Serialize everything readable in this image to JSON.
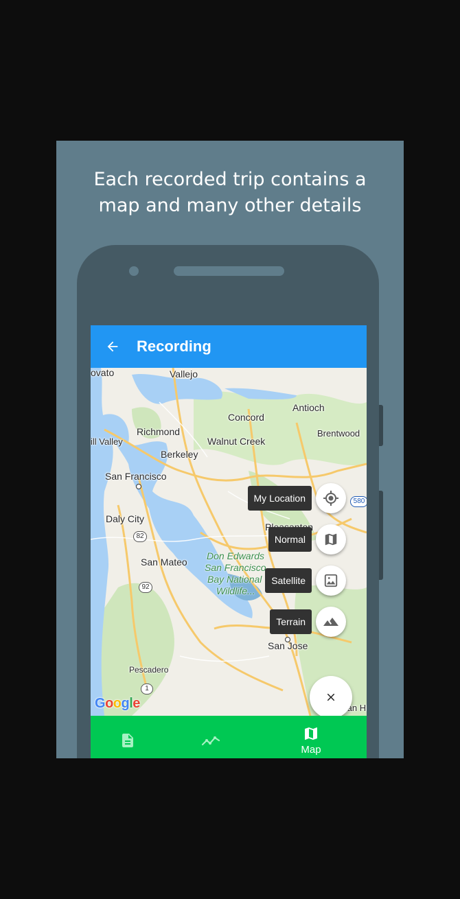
{
  "headline": {
    "line1": "Each recorded trip contains a",
    "line2": "map and many other details"
  },
  "appbar": {
    "title": "Recording",
    "back_icon": "arrow-back-icon"
  },
  "map": {
    "places": {
      "novato": "ovato",
      "vallejo": "Vallejo",
      "antioch": "Antioch",
      "concord": "Concord",
      "richmond": "Richmond",
      "walnut_creek": "Walnut Creek",
      "brentwood": "Brentwood",
      "mill_valley": "ill Valley",
      "berkeley": "Berkeley",
      "san_francisco": "San Francisco",
      "daly_city": "Daly City",
      "pleasanton": "Pleasanton",
      "san_mateo": "San Mateo",
      "san_jose": "San Jose",
      "pescadero": "Pescadero",
      "morgan_hill": "Morgan Hil"
    },
    "park": {
      "line1": "Don Edwards",
      "line2": "San Francisco",
      "line3": "Bay National",
      "line4": "Wildlife..."
    },
    "shields": {
      "s82": "82",
      "s92": "92",
      "s1": "1",
      "s580": "580"
    },
    "attribution": "Google",
    "colors": {
      "water": "#a8d0f5",
      "land": "#f1efe8",
      "green": "#c8e5b5",
      "highway": "#f6c96b"
    }
  },
  "fab_menu": {
    "my_location": "My Location",
    "normal": "Normal",
    "satellite": "Satellite",
    "terrain": "Terrain",
    "close_icon": "close-icon"
  },
  "bottom_nav": {
    "details_icon": "document-icon",
    "chart_icon": "chart-line-icon",
    "map_label": "Map",
    "map_icon": "map-icon",
    "color": "#00c853"
  }
}
